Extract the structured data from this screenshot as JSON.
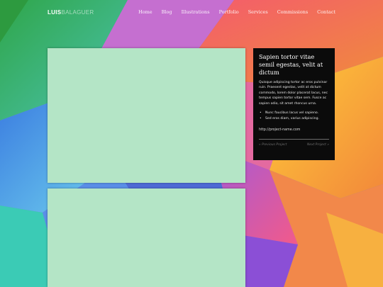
{
  "header": {
    "logo_bold": "LUIS",
    "logo_light": "BALAGUER"
  },
  "nav": {
    "items": [
      "Home",
      "Blog",
      "Illustrations",
      "Portfolio",
      "Services",
      "Commissions",
      "Contact"
    ]
  },
  "sidebar": {
    "title": "Sapien tortor vitae semil egestas, velit at dictum",
    "body": "Quisque adipiscing tortor ac eros pulvinar ruin. Praesent egestas, velit at dictum commodo, lorem dolor placerat lacus, nec tempus sapien tortor vitae sem. Fusce ac sapien odio, sit amet rhoncus urna.",
    "list": [
      "Nunc faucibus lacus vel sapieno.",
      "Sed eros diam, varius adipiscing."
    ],
    "link": "http://project-name.com",
    "prev": "« Previous Project",
    "next": "Next Project »"
  },
  "colors": {
    "card": "#b4e5c6",
    "panel": "#0b0b0b"
  }
}
